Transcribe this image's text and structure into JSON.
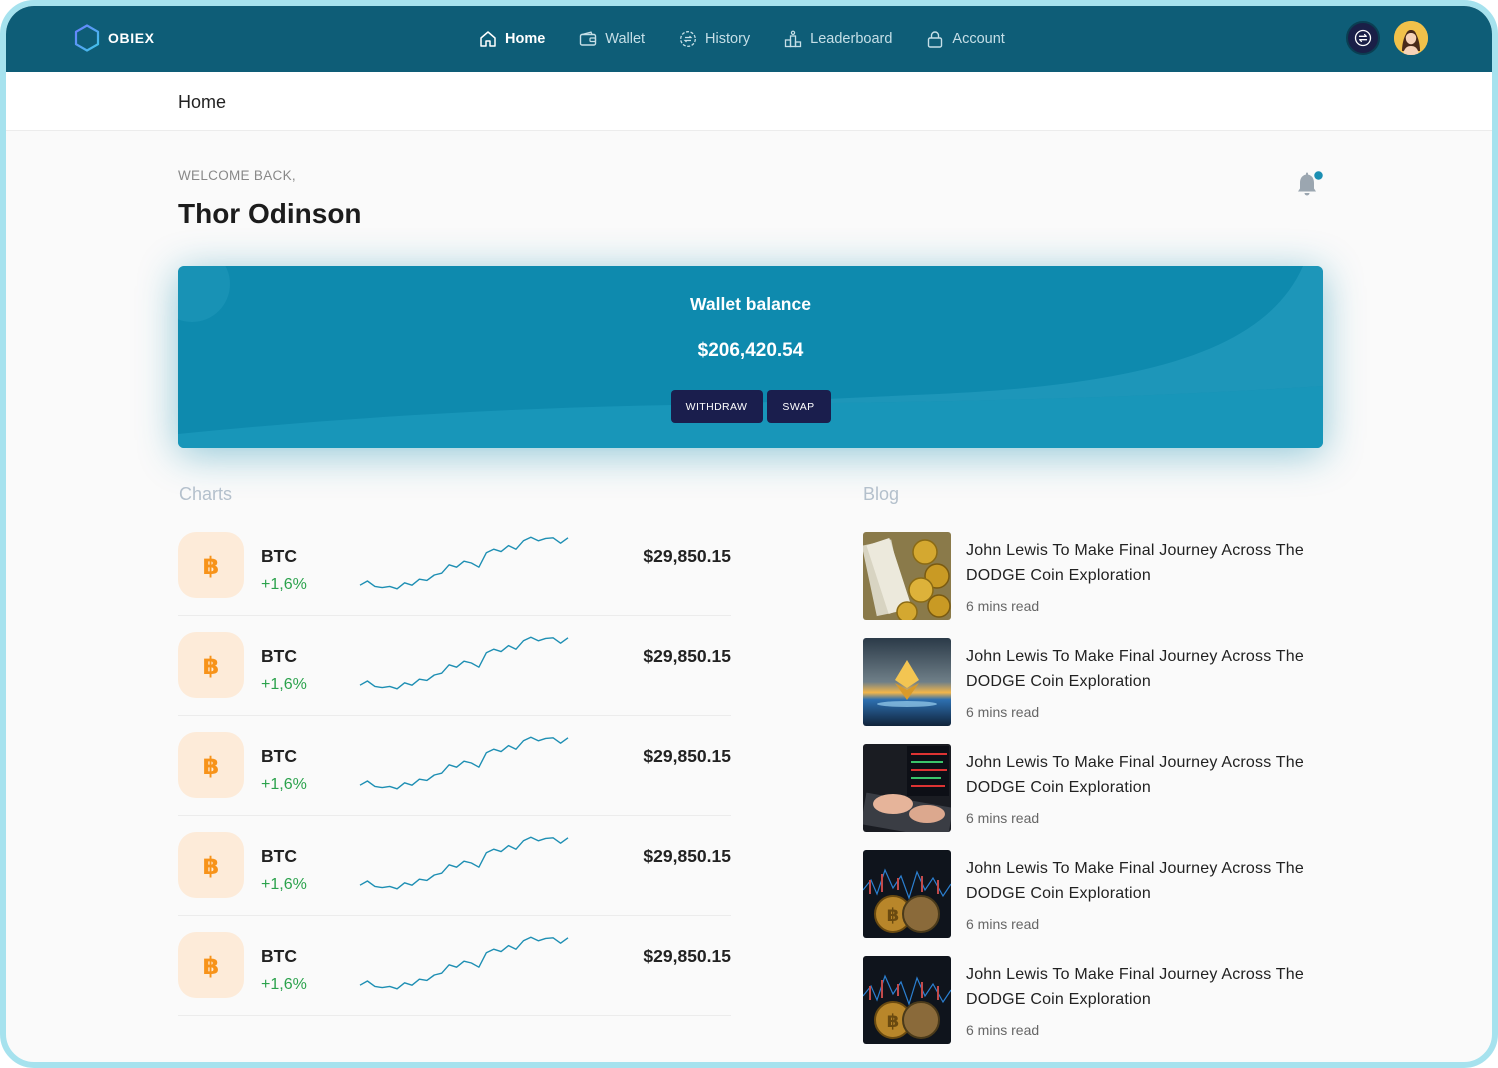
{
  "brand": {
    "name": "OBIEX"
  },
  "nav": {
    "items": [
      {
        "label": "Home",
        "icon": "home-icon",
        "active": true
      },
      {
        "label": "Wallet",
        "icon": "wallet-icon",
        "active": false
      },
      {
        "label": "History",
        "icon": "history-icon",
        "active": false
      },
      {
        "label": "Leaderboard",
        "icon": "leaderboard-icon",
        "active": false
      },
      {
        "label": "Account",
        "icon": "lock-icon",
        "active": false
      }
    ]
  },
  "breadcrumb": {
    "current": "Home"
  },
  "welcome": {
    "label": "WELCOME BACK,",
    "name": "Thor Odinson"
  },
  "wallet": {
    "title": "Wallet balance",
    "balance": "$206,420.54",
    "withdraw_label": "WITHDRAW",
    "swap_label": "SWAP"
  },
  "charts": {
    "title": "Charts",
    "rows": [
      {
        "symbol": "BTC",
        "change": "+1,6%",
        "price": "$29,850.15"
      },
      {
        "symbol": "BTC",
        "change": "+1,6%",
        "price": "$29,850.15"
      },
      {
        "symbol": "BTC",
        "change": "+1,6%",
        "price": "$29,850.15"
      },
      {
        "symbol": "BTC",
        "change": "+1,6%",
        "price": "$29,850.15"
      },
      {
        "symbol": "BTC",
        "change": "+1,6%",
        "price": "$29,850.15"
      }
    ]
  },
  "blog": {
    "title": "Blog",
    "posts": [
      {
        "title": "John Lewis To Make Final Journey Across The DODGE Coin Exploration",
        "meta": "6 mins read",
        "thumb": "coins-thumbnail"
      },
      {
        "title": "John Lewis To Make Final Journey Across The DODGE Coin Exploration",
        "meta": "6 mins read",
        "thumb": "ethereum-thumbnail"
      },
      {
        "title": "John Lewis To Make Final Journey Across The DODGE Coin Exploration",
        "meta": "6 mins read",
        "thumb": "trading-keyboard-thumbnail"
      },
      {
        "title": "John Lewis To Make Final Journey Across The DODGE Coin Exploration",
        "meta": "6 mins read",
        "thumb": "bitcoin-chart-thumbnail"
      },
      {
        "title": "John Lewis To Make Final Journey Across The DODGE Coin Exploration",
        "meta": "6 mins read",
        "thumb": "bitcoin-chart-thumbnail"
      }
    ]
  },
  "colors": {
    "nav_bg": "#0e5d77",
    "wallet_bg": "#0e8aae",
    "button_bg": "#1a1e4d",
    "positive": "#2ba24c",
    "bitcoin": "#f7931a",
    "sparkline": "#1e8fb3"
  }
}
